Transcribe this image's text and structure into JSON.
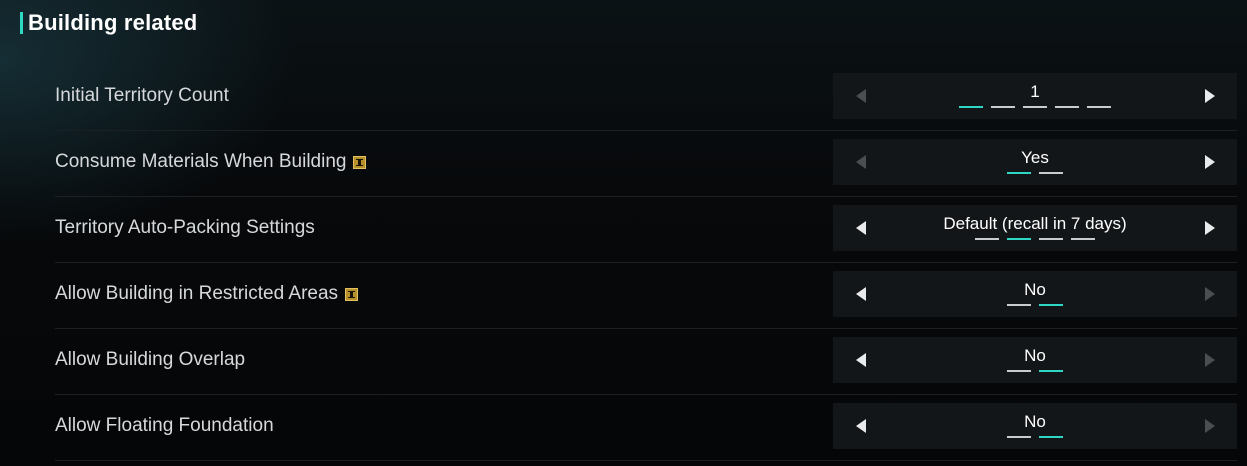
{
  "section": {
    "title": "Building related",
    "accent_color": "#2fd8c4"
  },
  "settings": [
    {
      "label": "Initial Territory Count",
      "has_info": false,
      "value": "1",
      "options_count": 5,
      "selected_index": 0,
      "left_enabled": false,
      "right_enabled": true
    },
    {
      "label": "Consume Materials When Building",
      "has_info": true,
      "value": "Yes",
      "options_count": 2,
      "selected_index": 0,
      "left_enabled": false,
      "right_enabled": true
    },
    {
      "label": "Territory Auto-Packing Settings",
      "has_info": false,
      "value": "Default (recall in 7 days)",
      "options_count": 4,
      "selected_index": 1,
      "left_enabled": true,
      "right_enabled": true
    },
    {
      "label": "Allow Building in Restricted Areas",
      "has_info": true,
      "value": "No",
      "options_count": 2,
      "selected_index": 1,
      "left_enabled": true,
      "right_enabled": false
    },
    {
      "label": "Allow Building Overlap",
      "has_info": false,
      "value": "No",
      "options_count": 2,
      "selected_index": 1,
      "left_enabled": true,
      "right_enabled": false
    },
    {
      "label": "Allow Floating Foundation",
      "has_info": false,
      "value": "No",
      "options_count": 2,
      "selected_index": 1,
      "left_enabled": true,
      "right_enabled": false
    }
  ]
}
